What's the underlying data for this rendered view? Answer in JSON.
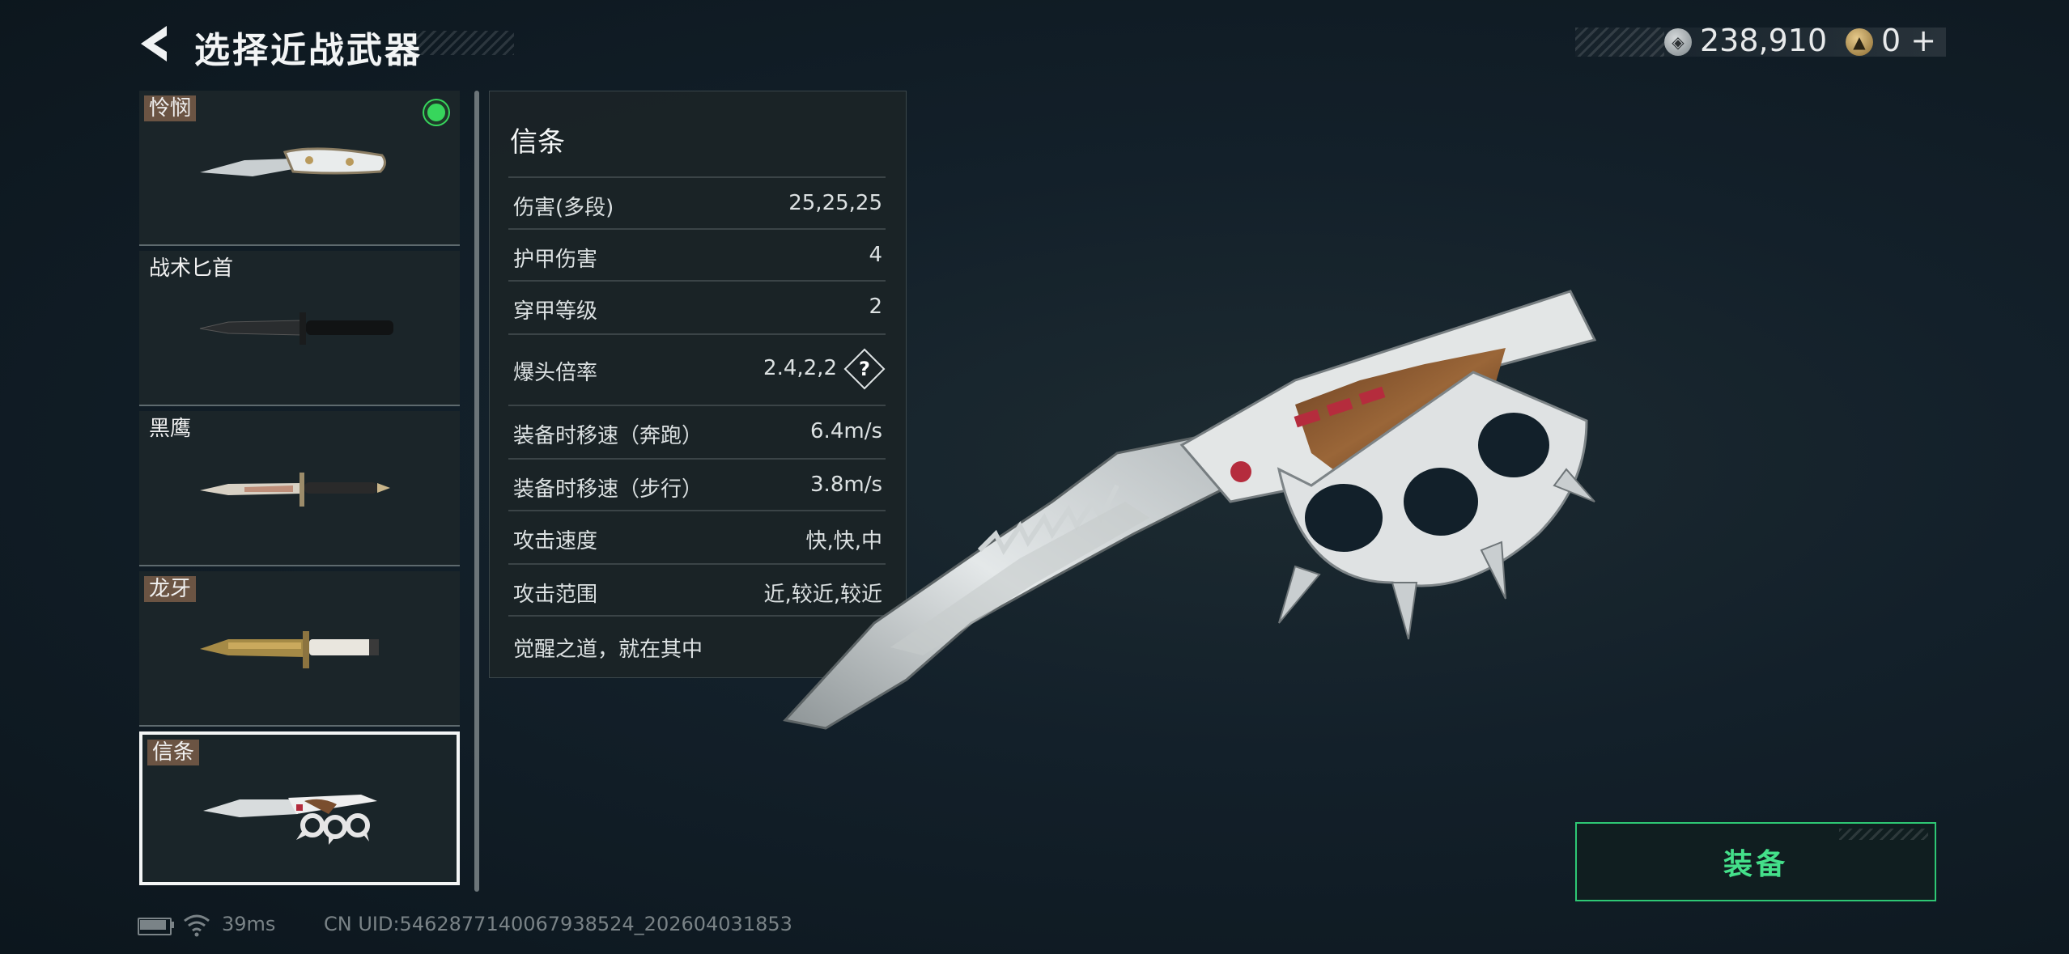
{
  "header": {
    "title": "选择近战武器"
  },
  "currency": [
    {
      "icon": "silver-coin-icon",
      "value": "238,910"
    },
    {
      "icon": "gold-coin-icon",
      "value": "0",
      "suffix": "+"
    }
  ],
  "weapons": [
    {
      "name": "怜悯",
      "tagged": true,
      "equipped": true
    },
    {
      "name": "战术匕首",
      "tagged": false
    },
    {
      "name": "黑鹰",
      "tagged": false
    },
    {
      "name": "龙牙",
      "tagged": true
    },
    {
      "name": "信条",
      "tagged": true,
      "selected": true
    }
  ],
  "panel": {
    "name": "信条",
    "stats": [
      {
        "label": "伤害(多段)",
        "value": "25,25,25"
      },
      {
        "label": "护甲伤害",
        "value": "4"
      },
      {
        "label": "穿甲等级",
        "value": "2"
      },
      {
        "label": "爆头倍率",
        "value": "2.4,2,2",
        "help": "?"
      },
      {
        "label": "装备时移速（奔跑）",
        "value": "6.4m/s"
      },
      {
        "label": "装备时移速（步行）",
        "value": "3.8m/s"
      },
      {
        "label": "攻击速度",
        "value": "快,快,中"
      },
      {
        "label": "攻击范围",
        "value": "近,较近,较近"
      }
    ],
    "description": "觉醒之道，就在其中"
  },
  "equip_button": {
    "label": "装备",
    "color": "#44e08a"
  },
  "footer": {
    "ping": "39ms",
    "uid": "CN UID:5462877140067938524_202604031853"
  },
  "colors": {
    "accent": "#2ec774",
    "equipped_dot": "#37d65c",
    "tag_bg": "#6b5443"
  }
}
